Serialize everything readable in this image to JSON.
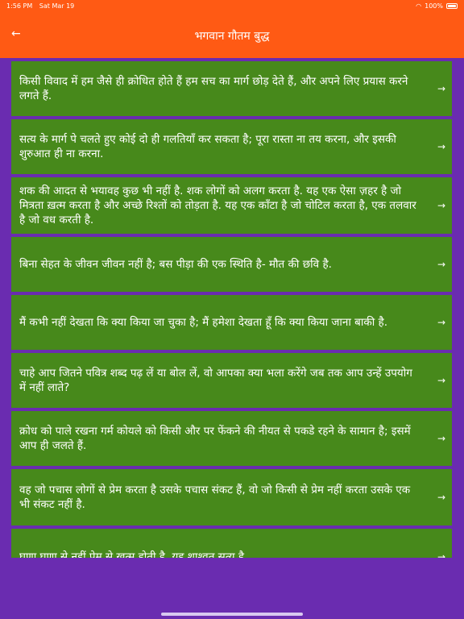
{
  "status": {
    "time": "1:56 PM",
    "date": "Sat Mar 19",
    "battery": "100%"
  },
  "nav": {
    "back_icon": "←",
    "title": "भगवान गौतम बुद्ध"
  },
  "quotes": [
    "किसी विवाद में हम जैसे ही क्रोधित होते हैं हम सच का मार्ग छोड़ देते हैं, और अपने लिए प्रयास करने लगते हैं.",
    "सत्य के मार्ग पे चलते हुए कोई दो ही गलतियाँ कर सकता है; पूरा रास्ता ना तय करना, और इसकी शुरुआत ही ना करना.",
    "शक की आदत से भयावह कुछ भी नहीं है. शक लोगों को अलग करता है. यह एक ऐसा ज़हर है जो मित्रता ख़त्म करता है और अच्छे रिश्तों को तोड़ता है. यह एक काँटा है जो चोटिल करता है, एक तलवार है जो वध करती है.",
    "बिना सेहत के जीवन जीवन नहीं है; बस पीड़ा की एक स्थिति है- मौत की छवि है.",
    "मैं कभी नहीं देखता कि क्या किया जा चुका है; मैं हमेशा देखता हूँ कि क्या किया जाना बाकी है.",
    "चाहे आप जितने पवित्र शब्द पढ़ लें या बोल लें, वो आपका क्या भला करेंगे जब तक आप उन्हें उपयोग में नहीं लाते?",
    "क्रोध को पाले रखना गर्म कोयले को किसी और पर फेंकने की नीयत से पकडे रहने के सामान है; इसमें आप ही जलते हैं.",
    "वह जो पचास लोगों से प्रेम करता है उसके पचास संकट हैं, वो  जो किसी से प्रेम नहीं करता उसके एक भी संकट नहीं है.",
    "घृणा घृणा से नहीं प्रेम से ख़त्म होती है, यह शाश्वत सत्य है."
  ],
  "row_arrow": "→",
  "colors": {
    "header": "#ff5a14",
    "row": "#47891b",
    "background": "#6a2cb0"
  }
}
